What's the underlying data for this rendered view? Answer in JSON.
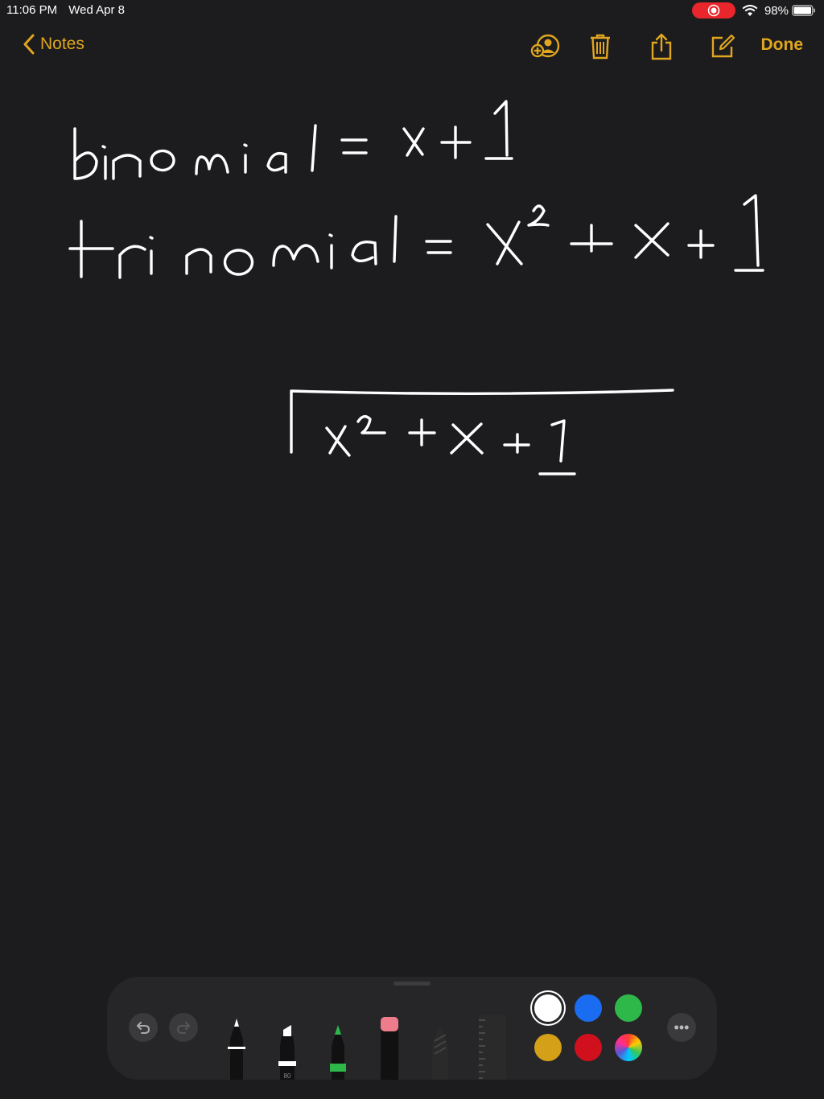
{
  "status": {
    "time": "11:06 PM",
    "date": "Wed Apr 8",
    "battery": "98%"
  },
  "nav": {
    "back_label": "Notes",
    "done_label": "Done"
  },
  "colors": {
    "accent": "#e0a61f",
    "background": "#1c1c1e",
    "record": "#e8262b"
  },
  "note": {
    "lines": [
      "binomial = x + 1",
      "trinomial = x² + x + 1",
      "x² + x + 1"
    ]
  },
  "toolbar": {
    "marker_size": "80",
    "icons": [
      "undo-icon",
      "redo-icon",
      "pen-tool",
      "marker-tool",
      "pencil-tool",
      "eraser-tool",
      "lasso-tool",
      "ruler-tool",
      "more-icon"
    ],
    "palette": [
      "#ffffff",
      "#1a6cf0",
      "#2fb84a",
      "#d4a017",
      "#d0101c",
      "color-wheel"
    ],
    "selected_color": "#ffffff",
    "more_label": "•••"
  }
}
